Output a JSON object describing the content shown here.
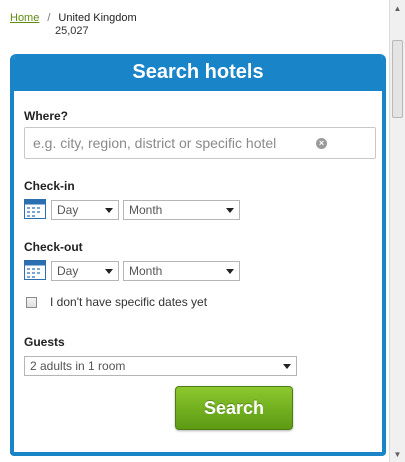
{
  "breadcrumb": {
    "home": "Home",
    "separator": "/",
    "current": "United Kingdom",
    "count": "25,027"
  },
  "panel": {
    "title": "Search hotels",
    "where": {
      "label": "Where?",
      "placeholder": "e.g. city, region, district or specific hotel"
    },
    "checkin": {
      "label": "Check-in",
      "day": "Day",
      "month": "Month"
    },
    "checkout": {
      "label": "Check-out",
      "day": "Day",
      "month": "Month"
    },
    "no_dates_label": "I don't have specific dates yet",
    "no_dates_checked": false,
    "guests": {
      "label": "Guests",
      "value": "2 adults in 1 room"
    },
    "search_button": "Search"
  },
  "colors": {
    "brand_blue": "#1a84c8",
    "button_green": "#6fae1c",
    "link_green": "#5f8b10"
  }
}
